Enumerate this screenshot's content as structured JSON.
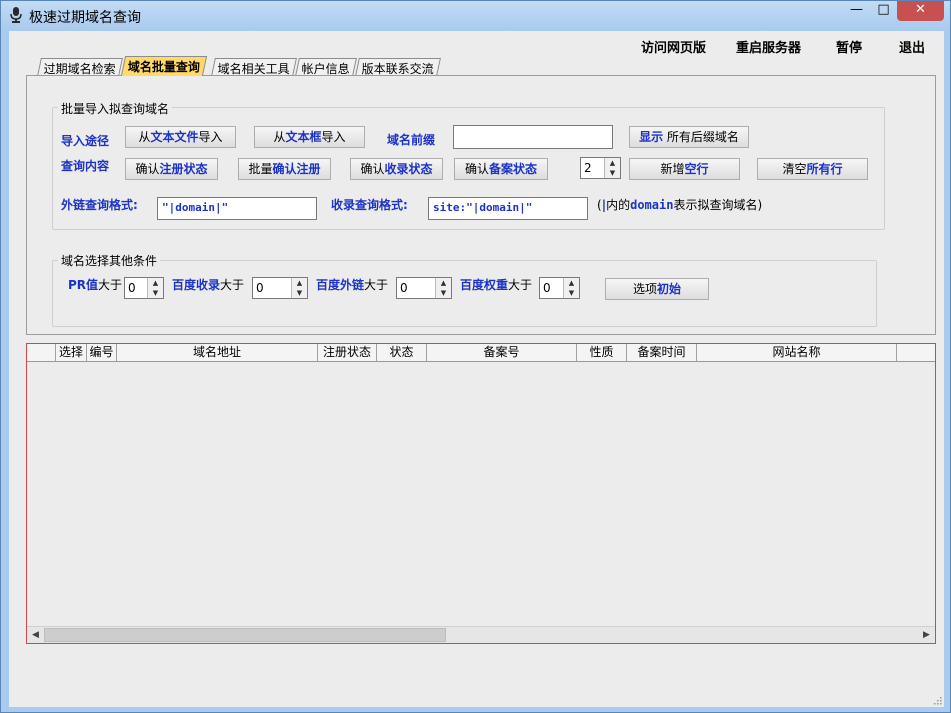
{
  "window": {
    "title": "极速过期域名查询",
    "min_glyph": "—",
    "max_glyph": "□",
    "close_glyph": "✕"
  },
  "menu": {
    "visit_web": "访问网页版",
    "restart_server": "重启服务器",
    "pause": "暂停",
    "exit": "退出"
  },
  "tabs": [
    "过期域名检索",
    "域名批量查询",
    "域名相关工具",
    "帐户信息",
    "版本联系交流"
  ],
  "import_group": {
    "title": "批量导入拟查询域名",
    "import_path_label": "导入途径",
    "from_file_pre": "从",
    "from_file_bold": "文本文件",
    "from_file_post": "导入",
    "from_box_pre": "从",
    "from_box_bold": "文本框",
    "from_box_post": "导入",
    "prefix_label": "域名前缀",
    "prefix_value": "",
    "show_bold": "显示",
    "show_rest": " 所有后缀域名",
    "query_content_label": "查询内容",
    "confirm_reg_pre": "确认",
    "confirm_reg_bold": "注册状态",
    "batch_reg_pre": "批量",
    "batch_reg_bold": "确认注册",
    "confirm_index_pre": "确认",
    "confirm_index_bold": "收录状态",
    "confirm_record_pre": "确认",
    "confirm_record_bold": "备案状态",
    "row_count": "2",
    "add_row_pre": "新增",
    "add_row_bold": "空行",
    "clear_rows_pre": "清空",
    "clear_rows_bold": "所有行",
    "backlink_label": "外链查询格式:",
    "backlink_value": "\"|domain|\"",
    "index_label": "收录查询格式:",
    "index_value": "site:\"|domain|\"",
    "note_pre": "(",
    "note_bar": "|",
    "note_mid": "内的",
    "note_domain": "domain",
    "note_post": "表示拟查询域名)"
  },
  "filter_group": {
    "title": "域名选择其他条件",
    "pr_bold": "PR值",
    "pr_rest": "大于",
    "pr_value": "0",
    "baidu_index_bold": "百度收录",
    "baidu_index_rest": "大于",
    "baidu_index_value": "0",
    "baidu_link_bold": "百度外链",
    "baidu_link_rest": "大于",
    "baidu_link_value": "0",
    "baidu_weight_bold": "百度权重",
    "baidu_weight_rest": "大于",
    "baidu_weight_value": "0",
    "reset_pre": "选项",
    "reset_bold": "初始"
  },
  "grid": {
    "columns": [
      "",
      "选择",
      "编号",
      "域名地址",
      "注册状态",
      "状态",
      "备案号",
      "性质",
      "备案时间",
      "网站名称"
    ]
  },
  "scroll": {
    "left": "◀",
    "right": "▶",
    "up": "▲",
    "down": "▼"
  }
}
